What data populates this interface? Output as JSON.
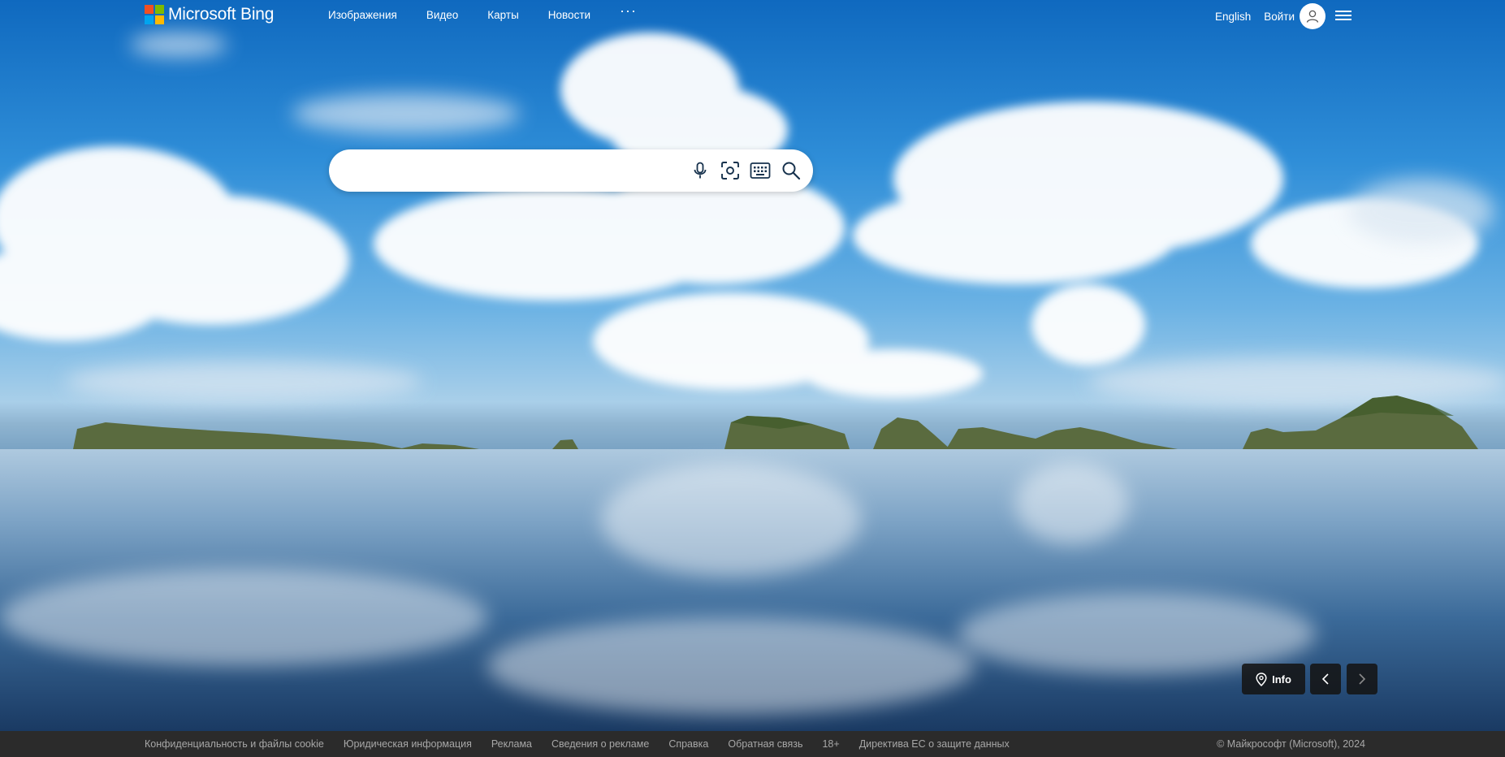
{
  "logo": {
    "text": "Microsoft Bing"
  },
  "colors": {
    "ms_red": "#f25022",
    "ms_green": "#7fba00",
    "ms_blue": "#00a4ef",
    "ms_yellow": "#ffb900",
    "accent": "#174ae4"
  },
  "nav": {
    "images": "Изображения",
    "video": "Видео",
    "maps": "Карты",
    "news": "Новости",
    "more": "···"
  },
  "header": {
    "language": "English",
    "sign_in": "Войти"
  },
  "search": {
    "value": "",
    "icons": [
      "microphone-icon",
      "visual-search-icon",
      "keyboard-icon",
      "search-icon"
    ]
  },
  "info_button": {
    "label": "Info"
  },
  "footer": {
    "links": [
      "Конфиденциальность и файлы cookie",
      "Юридическая информация",
      "Реклама",
      "Сведения о рекламе",
      "Справка",
      "Обратная связь",
      "18+",
      "Директива ЕС о защите данных"
    ],
    "copyright": "© Майкрософт (Microsoft), 2024"
  }
}
